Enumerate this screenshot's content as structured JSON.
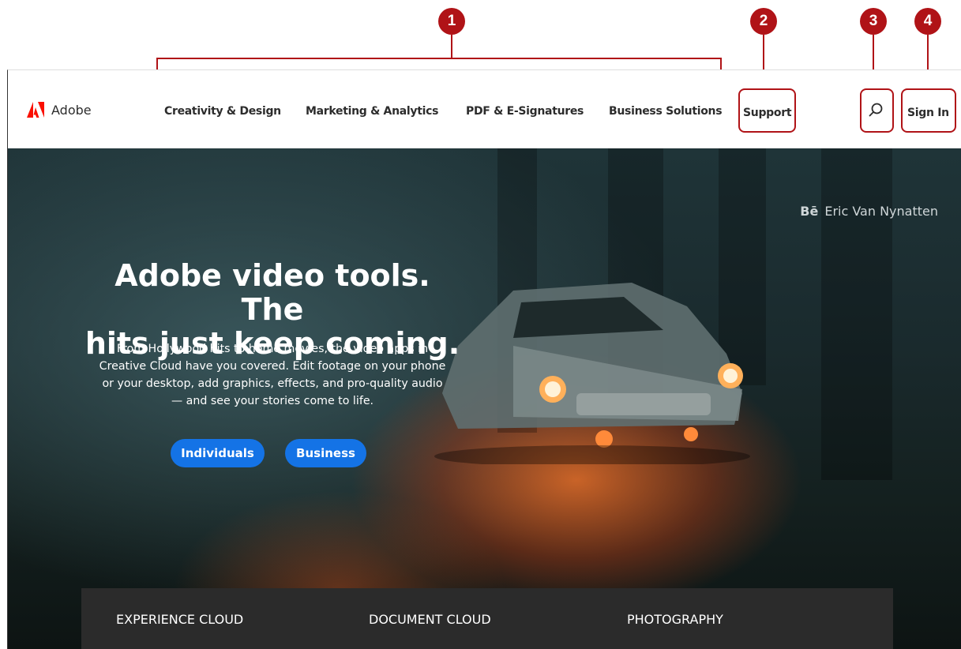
{
  "callouts": [
    "1",
    "2",
    "3",
    "4"
  ],
  "header": {
    "logo_text": "Adobe",
    "nav": [
      "Creativity & Design",
      "Marketing & Analytics",
      "PDF & E-Signatures",
      "Business Solutions"
    ],
    "support": "Support",
    "sign_in": "Sign In"
  },
  "hero": {
    "credit_mark": "Bē",
    "credit_name": "Eric Van Nynatten",
    "headline_line1": "Adobe video tools. The",
    "headline_line2": "hits just keep coming.",
    "body_lines": [
      "From Hollywood hits to home movies, the video apps in",
      "Creative Cloud have you covered. Edit footage on your phone",
      "or your desktop, add graphics, effects, and pro-quality audio",
      "— and see your stories come to life."
    ],
    "cta_individuals": "Individuals",
    "cta_business": "Business"
  },
  "panel": {
    "items": [
      "EXPERIENCE CLOUD",
      "DOCUMENT CLOUD",
      "PHOTOGRAPHY"
    ]
  },
  "colors": {
    "callout": "#b01317",
    "adobe_red": "#fa0f00",
    "cta_blue": "#1473e6"
  },
  "icons": {
    "logo": "adobe-logo-icon",
    "search": "search-icon"
  }
}
